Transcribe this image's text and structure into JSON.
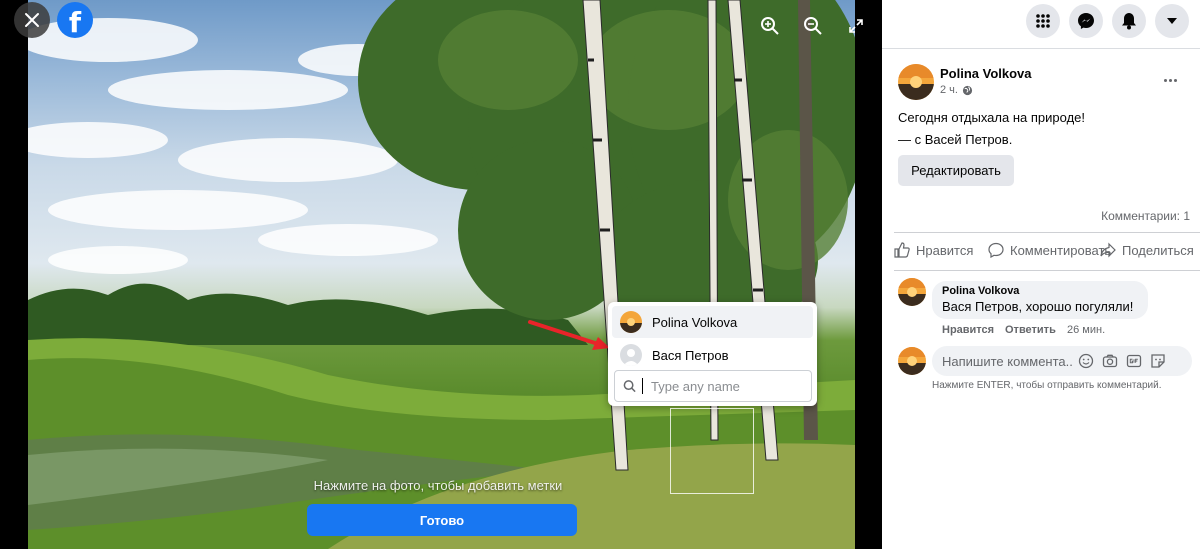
{
  "viewer": {
    "logo_letter": "f",
    "tag_hint": "Нажмите на фото, чтобы добавить метки",
    "done_label": "Готово",
    "tag_popup": {
      "suggestions": [
        {
          "name": "Polina Volkova",
          "selected": true
        },
        {
          "name": "Вася Петров",
          "selected": false
        }
      ],
      "search_placeholder": "Type any name"
    }
  },
  "post": {
    "author": "Polina Volkova",
    "time": "2 ч.",
    "text_line1": "Сегодня отдыхала на природе!",
    "text_line2": "— с Васей Петров.",
    "edit_label": "Редактировать",
    "comments_count": "Комментарии: 1",
    "actions": {
      "like": "Нравится",
      "comment": "Комментировать",
      "share": "Поделиться"
    }
  },
  "comment": {
    "author": "Polina Volkova",
    "tagged": "Вася Петров",
    "text": ", хорошо погуляли!",
    "like": "Нравится",
    "reply": "Ответить",
    "time": "26 мин."
  },
  "composer": {
    "placeholder": "Напишите коммента...",
    "hint": "Нажмите ENTER, чтобы отправить комментарий."
  },
  "colors": {
    "brand": "#1877f2",
    "annotation_arrow": "#e8242a"
  },
  "icons": [
    "close-icon",
    "facebook-logo",
    "zoom-in-icon",
    "zoom-out-icon",
    "fullscreen-icon",
    "menu-grid-icon",
    "messenger-icon",
    "notifications-icon",
    "account-dropdown-icon",
    "globe-icon",
    "more-icon",
    "like-icon",
    "comment-icon",
    "share-icon",
    "search-icon",
    "emoji-icon",
    "camera-icon",
    "gif-icon",
    "sticker-icon"
  ]
}
